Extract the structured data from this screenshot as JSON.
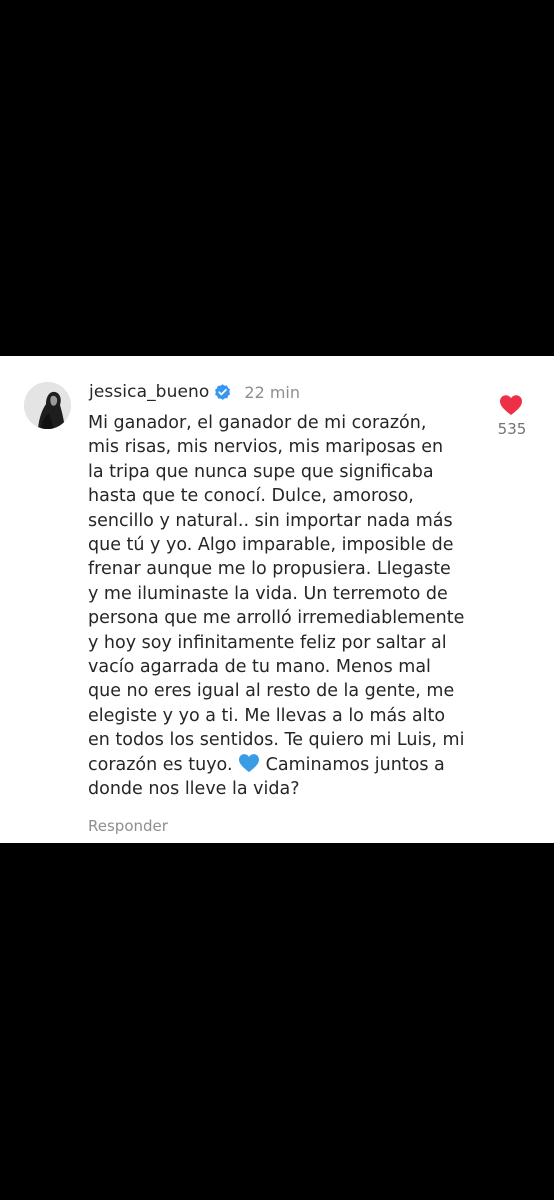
{
  "comment": {
    "username": "jessica_bueno",
    "verified": true,
    "time_ago": "22 min",
    "text_lines": [
      "Mi ganador, el ganador de mi corazón,",
      "mis risas, mis nervios, mis mariposas en",
      "la tripa que nunca supe que significaba",
      "hasta que te conocí. Dulce, amoroso,",
      "sencillo y natural.. sin importar nada más",
      "que tú y yo. Algo imparable, imposible de",
      "frenar aunque me lo propusiera. Llegaste",
      "y me iluminaste la vida. Un terremoto de",
      "persona que me arrolló irremediablemente",
      "y hoy soy infinitamente feliz por saltar al",
      "vacío agarrada de tu mano. Menos mal",
      "que no eres igual al resto de la gente, me",
      "elegiste y yo a ti. Me llevas a lo más alto",
      "en todos los sentidos. Te quiero mi Luis, mi",
      "corazón es tuyo.",
      "donde nos lleve la vida?"
    ],
    "line15_after_emoji": " Caminamos juntos a",
    "emoji_name": "blue-heart-icon",
    "reply_label": "Responder",
    "like_count": "535"
  },
  "colors": {
    "background": "#000000",
    "card": "#ffffff",
    "text": "#262626",
    "secondary_text": "#8e8e8e",
    "verified_badge": "#3797f0",
    "like_heart": "#ed2f47",
    "blue_heart_emoji": "#3b9ce6"
  }
}
